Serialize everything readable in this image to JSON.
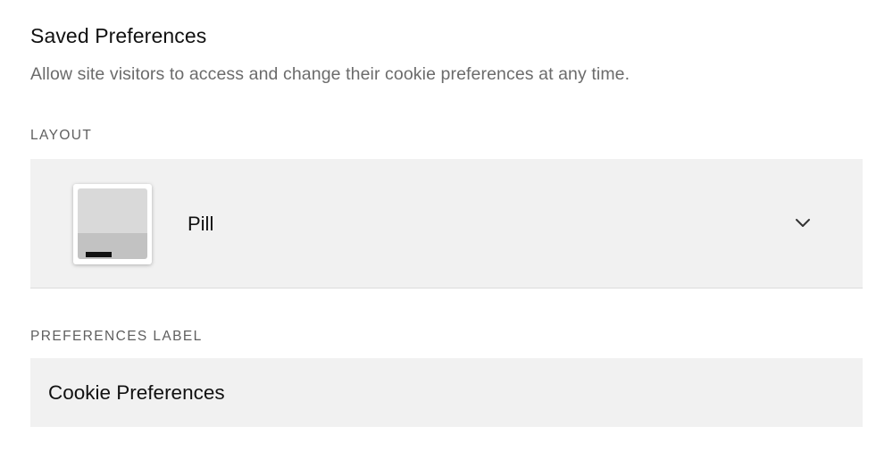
{
  "section": {
    "title": "Saved Preferences",
    "description": "Allow site visitors to access and change their cookie preferences at any time."
  },
  "layout": {
    "label": "LAYOUT",
    "selected": "Pill",
    "icon": "chevron-down-icon"
  },
  "preferences_label": {
    "label": "PREFERENCES LABEL",
    "value": "Cookie Preferences"
  },
  "colors": {
    "field_background": "#f1f1f1",
    "label_gray": "#5f5f5f",
    "description_gray": "#6b6b6b",
    "text": "#111111"
  }
}
